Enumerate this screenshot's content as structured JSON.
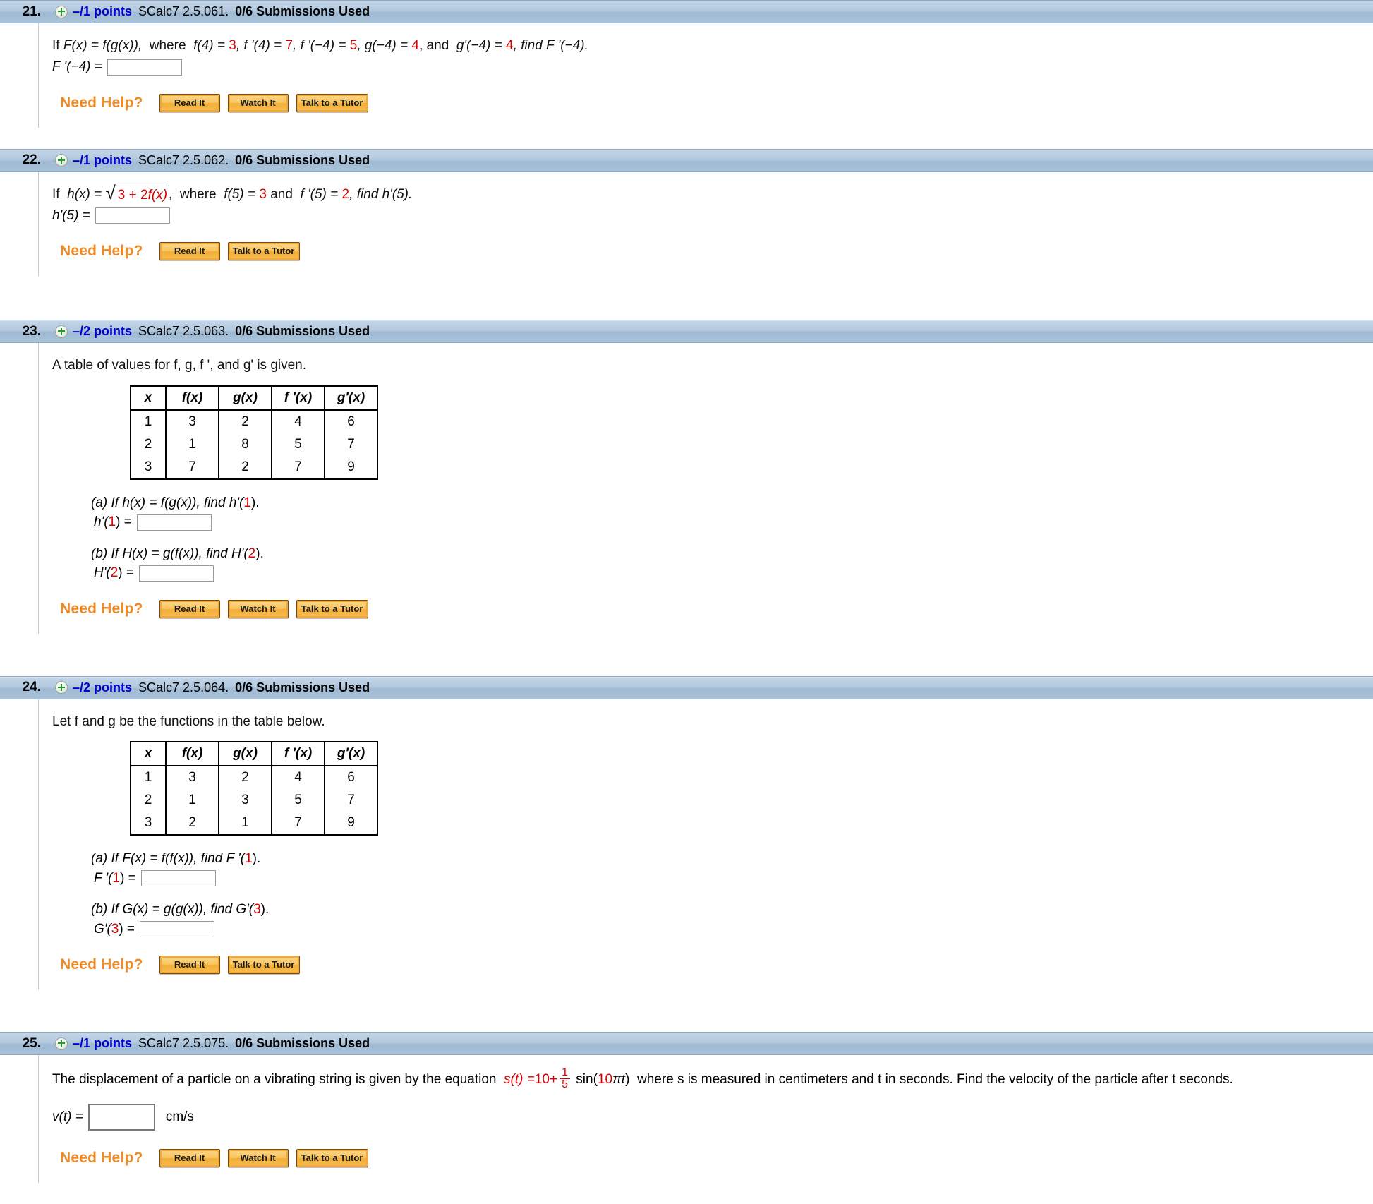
{
  "problems": [
    {
      "number": "21.",
      "points": "–/1 points",
      "code": "SCalc7 2.5.061.",
      "submissions": "0/6 Submissions Used",
      "icon": "plus-circle-icon",
      "statement_parts": {
        "lead": "If",
        "func_def": "F(x) = f(g(x)),",
        "where": "where",
        "v1_lhs": "f(4) = ",
        "v1_rhs": "3",
        "v2_lhs": ", f '(4) = ",
        "v2_rhs": "7",
        "v3_lhs": ", f '(−4) = ",
        "v3_rhs": "5",
        "v4_lhs": ", g(−4) = ",
        "v4_rhs": "4",
        "and": ",  and",
        "v5_lhs": "g'(−4) = ",
        "v5_rhs": "4",
        "tail": ", find F '(−4)."
      },
      "answer_label": "F '(−4) =",
      "answer_value": "",
      "need_help_label": "Need Help?",
      "buttons": [
        "Read It",
        "Watch It",
        "Talk to a Tutor"
      ]
    },
    {
      "number": "22.",
      "points": "–/1 points",
      "code": "SCalc7 2.5.062.",
      "submissions": "0/6 Submissions Used",
      "icon": "plus-circle-icon",
      "statement_parts": {
        "lead": "If",
        "func_lhs": "h(x) =",
        "radicand_a": "3 + 2",
        "radicand_b": "f(x)",
        "comma": ",",
        "where": "where",
        "v1_lhs": "f(5) = ",
        "v1_rhs": "3",
        "and": "and",
        "v2_lhs": "f '(5) = ",
        "v2_rhs": "2",
        "tail": ",  find h'(5)."
      },
      "answer_label": "h'(5) =",
      "answer_value": "",
      "need_help_label": "Need Help?",
      "buttons": [
        "Read It",
        "Talk to a Tutor"
      ]
    },
    {
      "number": "23.",
      "points": "–/2 points",
      "code": "SCalc7 2.5.063.",
      "submissions": "0/6 Submissions Used",
      "icon": "plus-circle-icon",
      "intro": "A table of values for f, g, f ', and g' is given.",
      "table": {
        "headers": [
          "x",
          "f(x)",
          "g(x)",
          "f '(x)",
          "g'(x)"
        ],
        "rows": [
          [
            "1",
            "3",
            "2",
            "4",
            "6"
          ],
          [
            "2",
            "1",
            "8",
            "5",
            "7"
          ],
          [
            "3",
            "7",
            "2",
            "7",
            "9"
          ]
        ]
      },
      "parts": [
        {
          "prompt_pre": "(a) If h(x) = f(g(x)), find h'(",
          "prompt_num": "1",
          "prompt_post": ").",
          "answer_label_pre": "h'(",
          "answer_label_num": "1",
          "answer_label_post": ") =",
          "answer_value": ""
        },
        {
          "prompt_pre": "(b) If  H(x) = g(f(x)), find H'(",
          "prompt_num": "2",
          "prompt_post": ").",
          "answer_label_pre": "H'(",
          "answer_label_num": "2",
          "answer_label_post": ") =",
          "answer_value": ""
        }
      ],
      "need_help_label": "Need Help?",
      "buttons": [
        "Read It",
        "Watch It",
        "Talk to a Tutor"
      ]
    },
    {
      "number": "24.",
      "points": "–/2 points",
      "code": "SCalc7 2.5.064.",
      "submissions": "0/6 Submissions Used",
      "icon": "plus-circle-icon",
      "intro": "Let f and g be the functions in the table below.",
      "table": {
        "headers": [
          "x",
          "f(x)",
          "g(x)",
          "f '(x)",
          "g'(x)"
        ],
        "rows": [
          [
            "1",
            "3",
            "2",
            "4",
            "6"
          ],
          [
            "2",
            "1",
            "3",
            "5",
            "7"
          ],
          [
            "3",
            "2",
            "1",
            "7",
            "9"
          ]
        ]
      },
      "parts": [
        {
          "prompt_pre": "(a) If F(x) = f(f(x)), find F '(",
          "prompt_num": "1",
          "prompt_post": ").",
          "answer_label_pre": "F '(",
          "answer_label_num": "1",
          "answer_label_post": ") =",
          "answer_value": ""
        },
        {
          "prompt_pre": "(b) If G(x) = g(g(x)), find G'(",
          "prompt_num": "3",
          "prompt_post": ").",
          "answer_label_pre": "G'(",
          "answer_label_num": "3",
          "answer_label_post": ") =",
          "answer_value": ""
        }
      ],
      "need_help_label": "Need Help?",
      "buttons": [
        "Read It",
        "Talk to a Tutor"
      ]
    },
    {
      "number": "25.",
      "points": "–/1 points",
      "code": "SCalc7 2.5.075.",
      "submissions": "0/6 Submissions Used",
      "icon": "plus-circle-icon",
      "statement_parts": {
        "lead": "The displacement of a particle on a vibrating string is given by the equation",
        "eq_lhs": "s(t) = ",
        "eq_const": "10",
        "eq_plus": " + ",
        "frac_num": "1",
        "frac_den": "5",
        "eq_sin_pre": "sin(",
        "eq_sin_arg": "10",
        "eq_sin_pi": "π",
        "eq_sin_t": "t",
        "eq_sin_post": ")",
        "tail": "where s is measured in centimeters and t in seconds. Find the velocity of the particle after t seconds."
      },
      "answer_label": "v(t) =",
      "answer_value": "",
      "answer_unit": "cm/s",
      "need_help_label": "Need Help?",
      "buttons": [
        "Read It",
        "Watch It",
        "Talk to a Tutor"
      ]
    }
  ],
  "colors": {
    "header_bar": "#a9c2d8",
    "points_blue": "#0000d0",
    "value_red": "#d60000",
    "need_help_orange": "#f08a24",
    "button_orange": "#f3ae36"
  }
}
